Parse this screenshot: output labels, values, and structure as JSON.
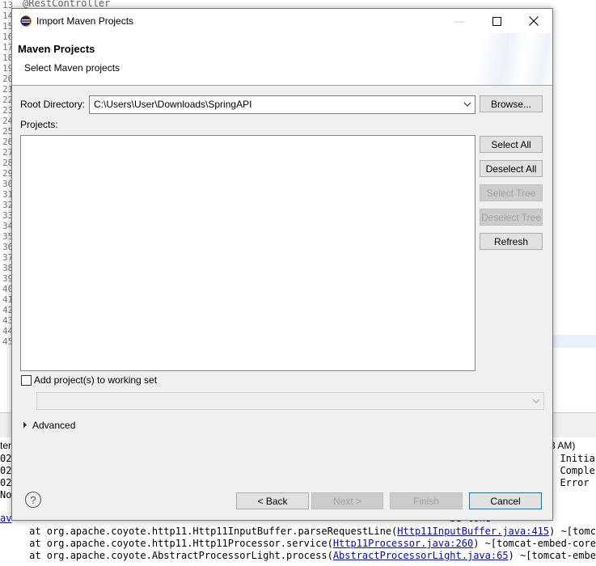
{
  "ide": {
    "line_numbers": [
      "13",
      "14",
      "15",
      "16",
      "17",
      "18",
      "19",
      "20",
      "21",
      "22",
      "23",
      "24",
      "25",
      "26",
      "27",
      "28",
      "29",
      "30",
      "31",
      "32",
      "33",
      "34",
      "35",
      "36",
      "37",
      "38",
      "39",
      "40",
      "41",
      "42",
      "43",
      "44",
      "45"
    ],
    "top_code": "@RestController",
    "console_left": [
      "ter",
      "02",
      "02",
      "02",
      "No"
    ],
    "console_right_header": "3 AM)",
    "console_right": [
      ": Initia",
      ": Comple",
      ": Error "
    ],
    "console_trace": [
      {
        "pre": "av",
        "mid": "",
        "link": "",
        "post": "                                                                           be toke"
      },
      {
        "pre": "     at org.apache.coyote.http11.Http11InputBuffer.parseRequestLine(",
        "link": "Http11InputBuffer.java:415",
        "post": ") ~[tomcat"
      },
      {
        "pre": "     at org.apache.coyote.http11.Http11Processor.service(",
        "link": "Http11Processor.java:260",
        "post": ") ~[tomcat-embed-core-"
      },
      {
        "pre": "     at org.apache.coyote.AbstractProcessorLight.process(",
        "link": "AbstractProcessorLight.java:65",
        "post": ") ~[tomcat-embed"
      }
    ]
  },
  "dialog": {
    "title": "Import Maven Projects",
    "minimize": "—",
    "maximize": "☐",
    "close": "✕",
    "header_title": "Maven Projects",
    "header_subtitle": "Select Maven projects",
    "root_label": "Root Directory:",
    "root_value": "C:\\Users\\User\\Downloads\\SpringAPI",
    "browse": "Browse...",
    "projects_label": "Projects:",
    "select_all": "Select All",
    "deselect_all": "Deselect All",
    "select_tree": "Select Tree",
    "deselect_tree": "Deselect Tree",
    "refresh": "Refresh",
    "add_working_set": "Add project(s) to working set",
    "working_set_value": "",
    "advanced": "Advanced",
    "help": "?",
    "back": "< Back",
    "next": "Next >",
    "finish": "Finish",
    "cancel": "Cancel"
  }
}
